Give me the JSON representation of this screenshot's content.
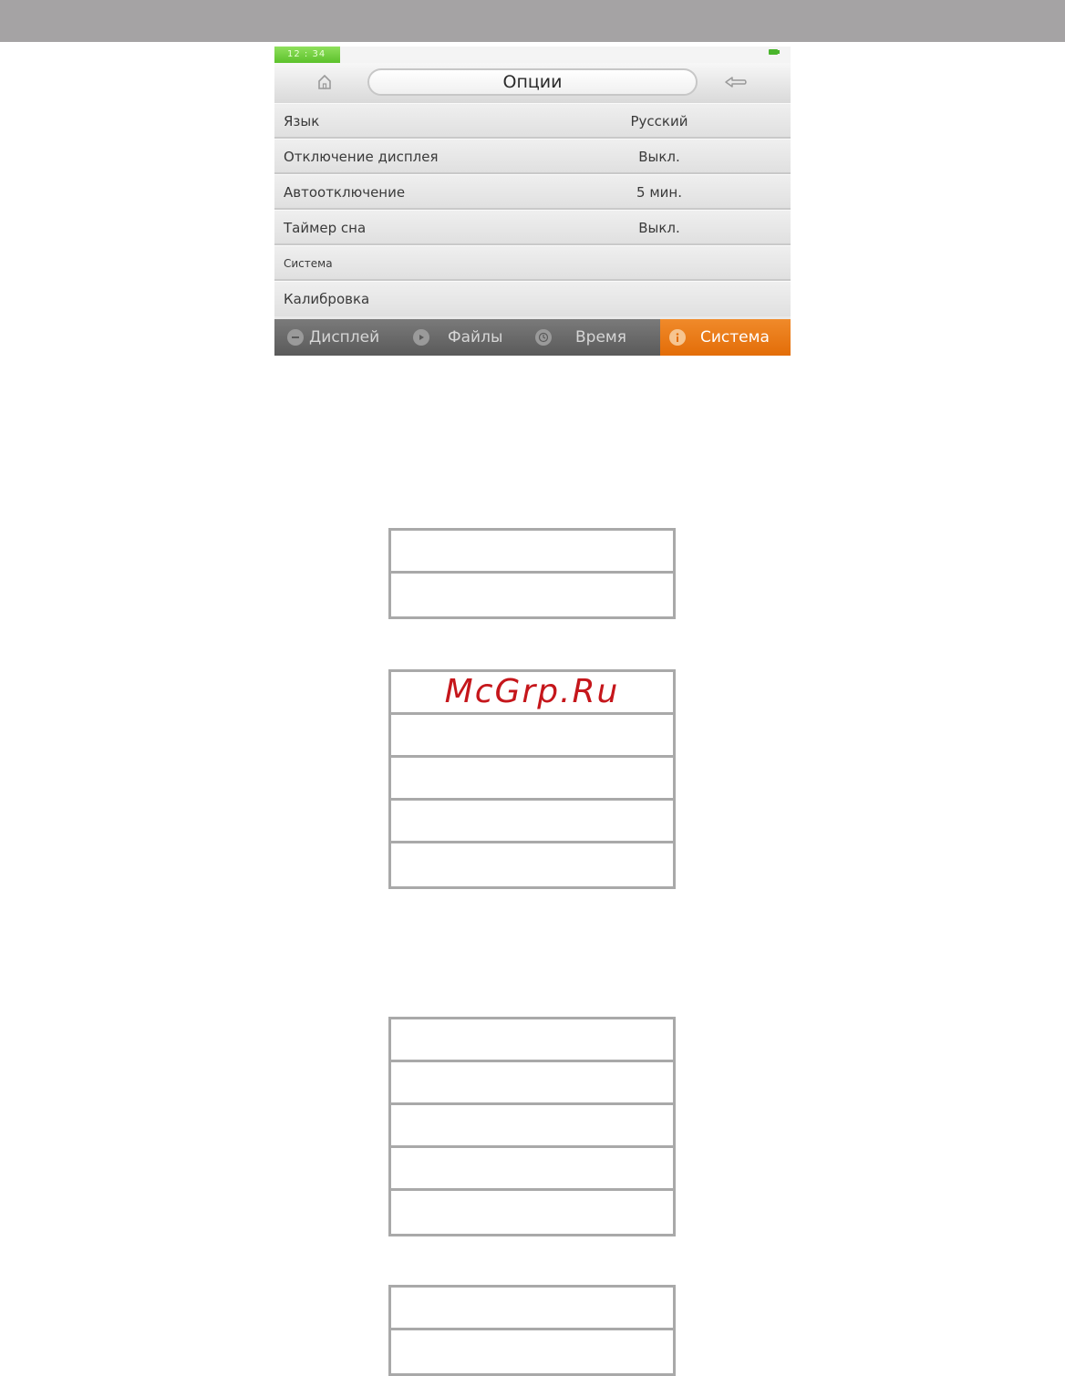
{
  "status": {
    "clock": "12 : 34"
  },
  "header": {
    "title": "Опции"
  },
  "settings": [
    {
      "label": "Язык",
      "value": "Русский"
    },
    {
      "label": "Отключение дисплея",
      "value": "Выкл."
    },
    {
      "label": "Автоотключение",
      "value": "5 мин."
    },
    {
      "label": "Таймер сна",
      "value": "Выкл."
    },
    {
      "label": "Система",
      "value": ""
    },
    {
      "label": "Калибровка",
      "value": ""
    }
  ],
  "tabs": [
    {
      "label": "Дисплей",
      "icon": "minus-circle-icon",
      "active": false
    },
    {
      "label": "Файлы",
      "icon": "play-circle-icon",
      "active": false
    },
    {
      "label": "Время",
      "icon": "clock-icon",
      "active": false
    },
    {
      "label": "Система",
      "icon": "info-icon",
      "active": true
    }
  ],
  "watermark": "McGrp.Ru",
  "colors": {
    "active_tab": "#e87a14",
    "clock_bg": "#6fcf3a",
    "watermark": "#c5161b"
  }
}
